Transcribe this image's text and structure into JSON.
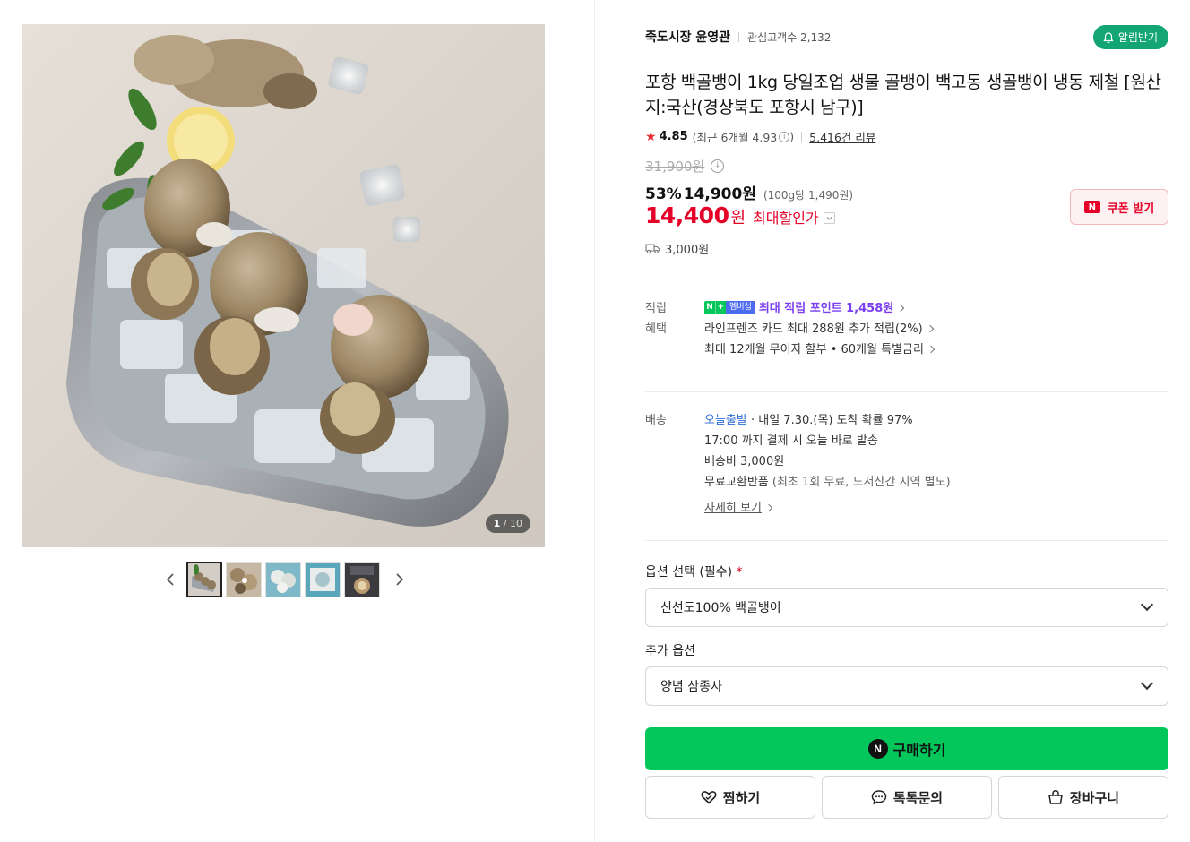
{
  "gallery": {
    "counter_current": "1",
    "counter_total": "/ 10",
    "thumbnail_count": 5
  },
  "store": {
    "name": "죽도시장 윤영관",
    "fans": "관심고객수 2,132",
    "alarm_label": "알림받기"
  },
  "product": {
    "title": "포항 백골뱅이 1kg 당일조업 생물 골뱅이 백고동 생골뱅이 냉동 제철 [원산지:국산(경상북도 포항시 남구)]",
    "rating": "4.85",
    "recent_rating": "(최근 6개월 4.93",
    "recent_rating_close": ")",
    "reviews": "5,416건 리뷰",
    "original_price": "31,900원",
    "discount_rate": "53%",
    "discount_price": "14,900원",
    "unit_price": "(100g당 1,490원)",
    "max_price": "14,400",
    "max_won": "원",
    "max_label": "최대할인가",
    "coupon_label": "쿠폰 받기",
    "shipping_fee": "3,000원"
  },
  "benefits": {
    "points_label": "적립",
    "membership_badge": "멤버십",
    "points_text": "최대 적립 포인트 1,458원",
    "benefit_label": "혜택",
    "benefit_lines": [
      "라인프렌즈 카드 최대 288원 추가 적립(2%)",
      "최대 12개월 무이자 할부 • 60개월 특별금리"
    ]
  },
  "delivery": {
    "label": "배송",
    "today": "오늘출발",
    "arrival": " · 내일 7.30.(목) 도착 확률 97%",
    "cutoff": "17:00 까지 결제 시 오늘 바로 발송",
    "fee": "배송비 3,000원",
    "return_main": "무료교환반품",
    "return_note": " (최초 1회 무료, 도서산간 지역 별도)",
    "detail_link": "자세히 보기"
  },
  "options": {
    "required_label": "옵션 선택 (필수)",
    "required_mark": "*",
    "required_value": "신선도100% 백골뱅이",
    "extra_label": "추가 옵션",
    "extra_value": "양념 삼종사"
  },
  "actions": {
    "buy": "구매하기",
    "wish": "찜하기",
    "talk": "톡톡문의",
    "cart": "장바구니"
  },
  "colors": {
    "accent_green": "#03c75a",
    "price_red": "#e50027",
    "alarm_green": "#13a574"
  }
}
